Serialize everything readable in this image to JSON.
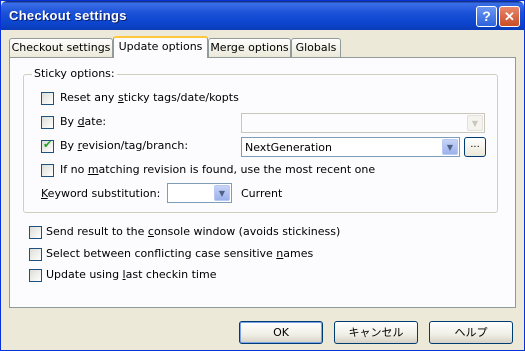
{
  "window": {
    "title": "Checkout settings",
    "help_glyph": "?",
    "close_glyph": "✕"
  },
  "tabs": [
    {
      "label": "Checkout settings"
    },
    {
      "label": "Update options"
    },
    {
      "label": "Merge options"
    },
    {
      "label": "Globals"
    }
  ],
  "active_tab": "Update options",
  "sticky": {
    "group_label": "Sticky options:",
    "reset": {
      "label_pre": "Reset any ",
      "label_key": "s",
      "label_post": "ticky tags/date/kopts",
      "checked": false
    },
    "by_date": {
      "label_pre": "By ",
      "label_key": "d",
      "label_post": "ate:",
      "checked": false,
      "value": ""
    },
    "by_revision": {
      "label_pre": "By ",
      "label_key": "r",
      "label_post": "evision/tag/branch:",
      "checked": true,
      "value": "NextGeneration",
      "browse_label": "..."
    },
    "no_match": {
      "label_pre": "If no ",
      "label_key": "m",
      "label_post": "atching revision is found, use the most recent one",
      "checked": false
    },
    "keyword": {
      "label_key": "K",
      "label_post": "eyword substitution:",
      "value": "",
      "current_label": "Current"
    }
  },
  "options": {
    "console": {
      "label_pre": "Send result to the ",
      "label_key": "c",
      "label_post": "onsole window (avoids stickiness)",
      "checked": false
    },
    "case": {
      "label_pre": "Select between conflicting case sensitive ",
      "label_key": "n",
      "label_post": "ames",
      "checked": false
    },
    "checkin": {
      "label_pre": "Update using ",
      "label_key": "l",
      "label_post": "ast checkin time",
      "checked": false
    }
  },
  "buttons": {
    "ok": "OK",
    "cancel": "キャンセル",
    "help": "ヘルプ"
  },
  "icons": {
    "dropdown": "▼",
    "check": "✔"
  }
}
